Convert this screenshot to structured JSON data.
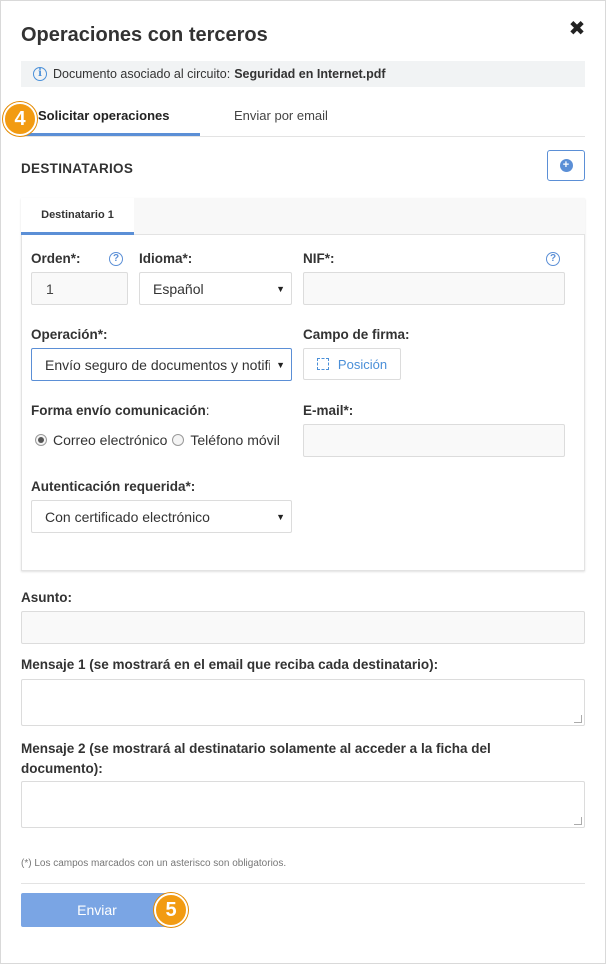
{
  "dialog": {
    "title": "Operaciones con terceros",
    "close_glyph": "✖"
  },
  "info": {
    "icon": "info-icon",
    "text": "Documento asociado al circuito:",
    "document": "Seguridad en Internet.pdf"
  },
  "tabs": [
    {
      "label": "Solicitar operaciones",
      "active": true
    },
    {
      "label": "Enviar por email",
      "active": false
    }
  ],
  "badges": {
    "step4": "4",
    "step5": "5",
    "color": "#f29b12"
  },
  "recipients": {
    "section_title": "DESTINATARIOS",
    "add_icon": "+",
    "tab_label": "Destinatario 1",
    "order": {
      "label": "Orden*:",
      "value": "1",
      "help": "?"
    },
    "language": {
      "label": "Idioma*:",
      "value": "Español"
    },
    "nif": {
      "label": "NIF*:",
      "value": "",
      "help": "?"
    },
    "operation": {
      "label": "Operación*:",
      "value": "Envío seguro de documentos y notificaciones"
    },
    "signature_field": {
      "label": "Campo de firma:",
      "button": "Posición"
    },
    "delivery": {
      "label": "Forma envío comunicación",
      "colon": ":",
      "options": [
        {
          "label": "Correo electrónico",
          "selected": true
        },
        {
          "label": "Teléfono móvil",
          "selected": false
        }
      ]
    },
    "email": {
      "label": "E-mail*:",
      "value": ""
    },
    "auth": {
      "label": "Autenticación requerida*:",
      "value": "Con certificado electrónico"
    }
  },
  "subject": {
    "label": "Asunto:",
    "value": ""
  },
  "message1": {
    "label": "Mensaje 1 (se mostrará en el email que reciba cada destinatario):",
    "value": ""
  },
  "message2": {
    "label_line1": "Mensaje 2 (se mostrará al destinatario solamente al acceder a la ficha del",
    "label_line2": "documento):",
    "value": ""
  },
  "footnote": "(*) Los campos marcados con un asterisco son obligatorios.",
  "submit": {
    "label": "Enviar"
  },
  "colors": {
    "accent": "#5b8fd6",
    "button": "#7aa5e4",
    "badge": "#f29b12"
  }
}
